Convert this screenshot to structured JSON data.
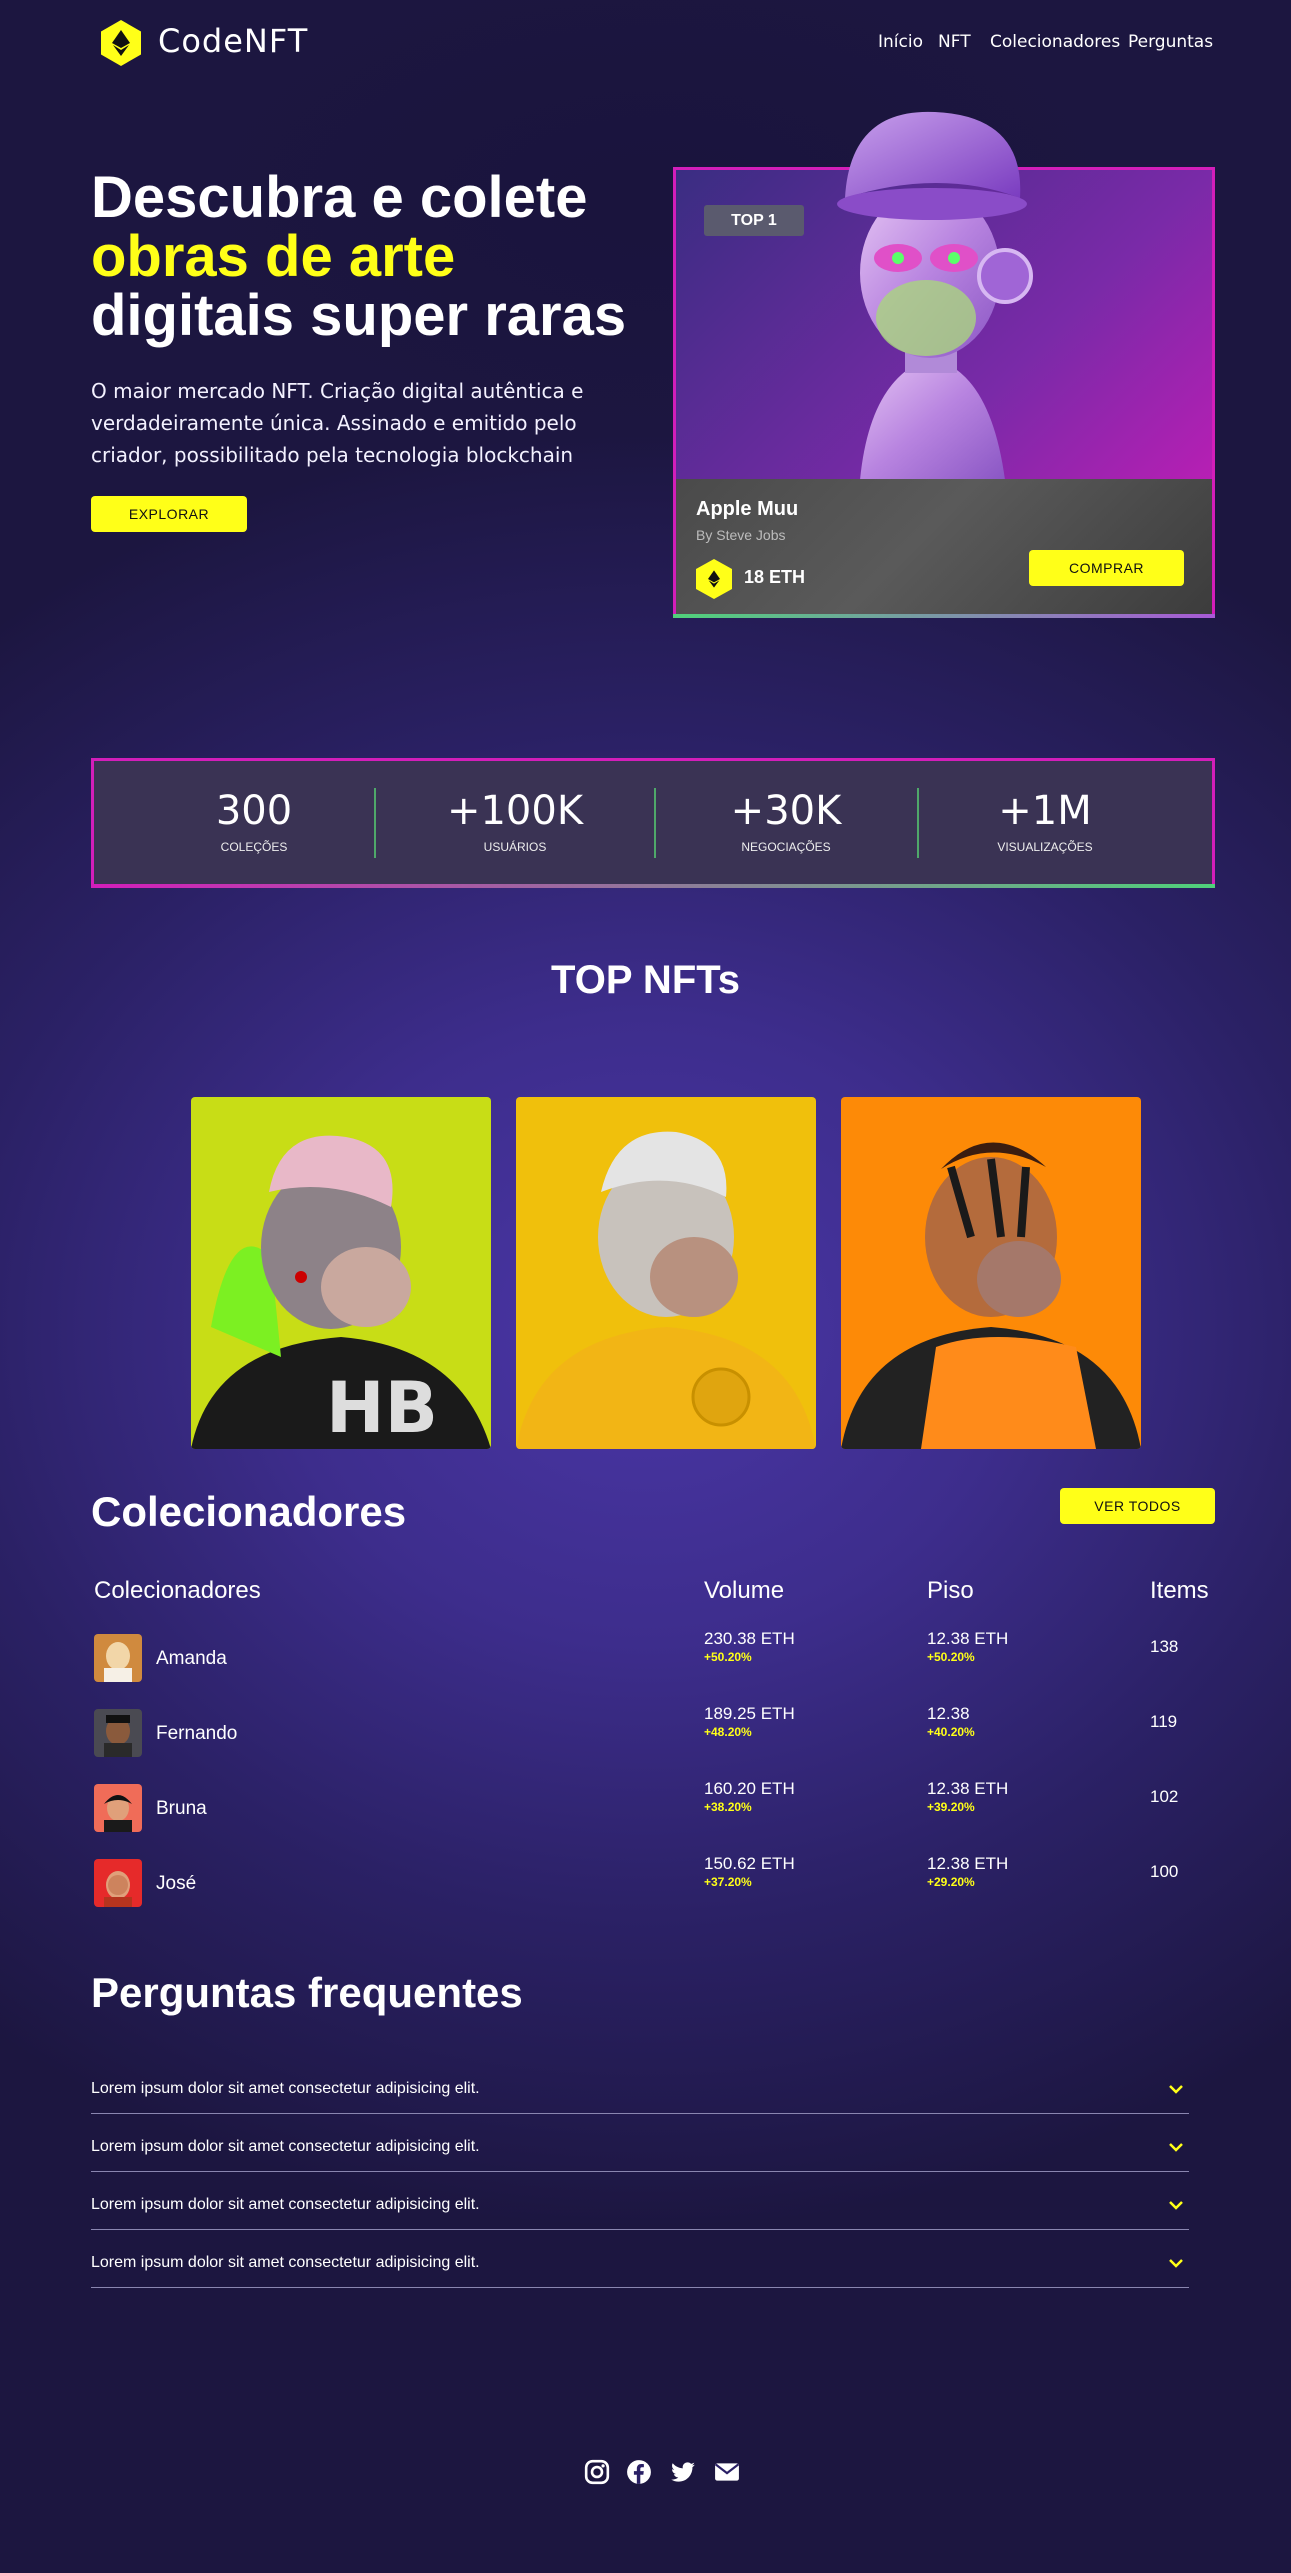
{
  "brand": {
    "name": "CodeNFT",
    "logo_icon": "ethereum-icon",
    "accent": "#ffff18"
  },
  "nav": {
    "items": [
      "Início",
      "NFT",
      "Colecionadores",
      "Perguntas"
    ]
  },
  "hero": {
    "title_line1": "Descubra e colete",
    "title_line2": "obras de arte",
    "title_line3": "digitais super raras",
    "description": "O maior mercado NFT. Criação digital autêntica e verdadeiramente única. Assinado e emitido pelo criador, possibilitado pela tecnologia blockchain",
    "explore_label": "EXPLORAR"
  },
  "featured": {
    "badge": "TOP 1",
    "title": "Apple Muu",
    "author": "By Steve Jobs",
    "price": "18 ETH",
    "buy_label": "COMPRAR"
  },
  "stats": [
    {
      "value": "300",
      "label": "COLEÇÕES"
    },
    {
      "value": "+100K",
      "label": "USUÁRIOS"
    },
    {
      "value": "+30K",
      "label": "NEGOCIAÇÕES"
    },
    {
      "value": "+1M",
      "label": "VISUALIZAÇÕES"
    }
  ],
  "top_nfts": {
    "title": "TOP NFTs",
    "cards": [
      {
        "bg": "#c8dd16"
      },
      {
        "bg": "#f0c00c"
      },
      {
        "bg": "#fd8a07"
      }
    ]
  },
  "collectors": {
    "title": "Colecionadores",
    "see_all_label": "VER TODOS",
    "headers": [
      "Colecionadores",
      "Volume",
      "Piso",
      "Items"
    ],
    "rows": [
      {
        "name": "Amanda",
        "volume": "230.38 ETH",
        "volume_change": "+50.20%",
        "floor": "12.38 ETH",
        "floor_change": "+50.20%",
        "items": "138"
      },
      {
        "name": "Fernando",
        "volume": "189.25 ETH",
        "volume_change": "+48.20%",
        "floor": "12.38",
        "floor_change": "+40.20%",
        "items": "119"
      },
      {
        "name": "Bruna",
        "volume": "160.20 ETH",
        "volume_change": "+38.20%",
        "floor": "12.38 ETH",
        "floor_change": "+39.20%",
        "items": "102"
      },
      {
        "name": "José",
        "volume": "150.62 ETH",
        "volume_change": "+37.20%",
        "floor": "12.38 ETH",
        "floor_change": "+29.20%",
        "items": "100"
      }
    ]
  },
  "faq": {
    "title": "Perguntas frequentes",
    "items": [
      "Lorem ipsum dolor sit amet consectetur adipisicing elit.",
      "Lorem ipsum dolor sit amet consectetur adipisicing elit.",
      "Lorem ipsum dolor sit amet consectetur adipisicing elit.",
      "Lorem ipsum dolor sit amet consectetur adipisicing elit."
    ]
  },
  "footer": {
    "social_icons": [
      "instagram-icon",
      "facebook-icon",
      "twitter-icon",
      "email-icon"
    ]
  }
}
